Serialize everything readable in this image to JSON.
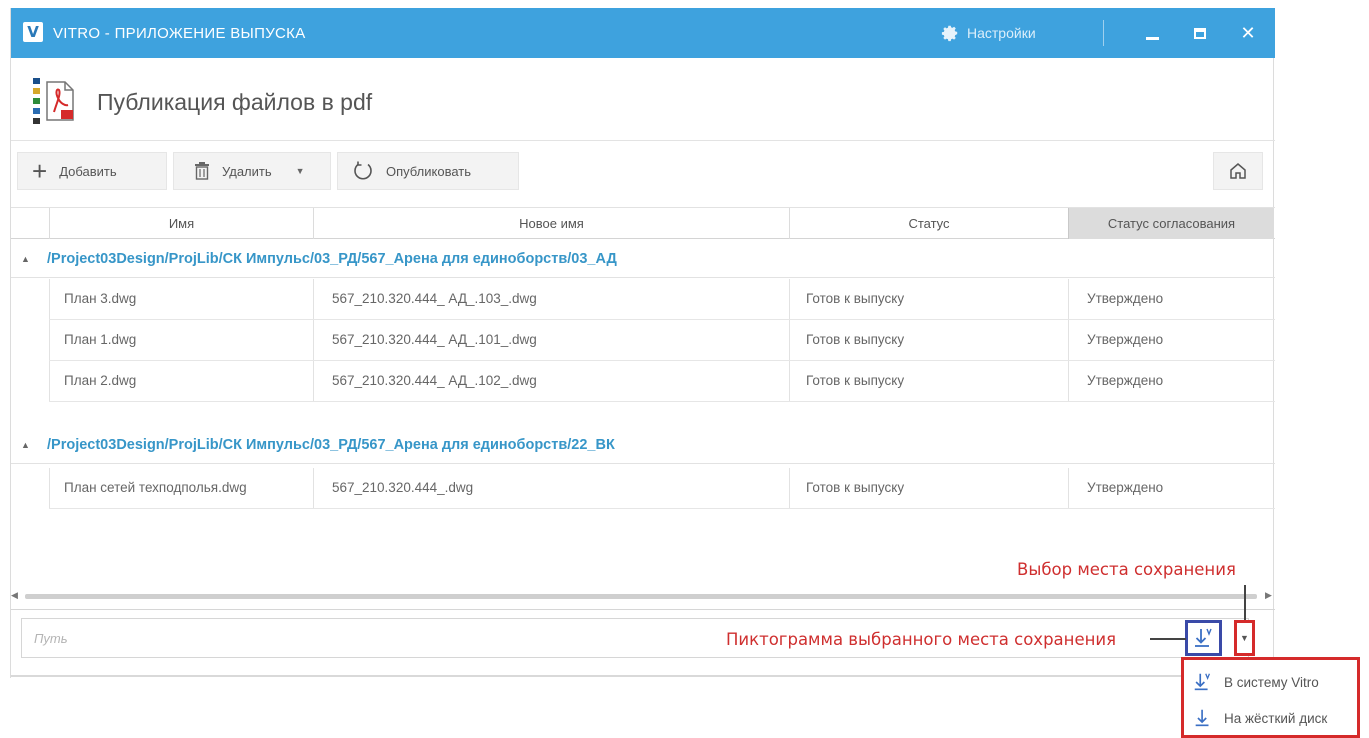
{
  "window": {
    "title": "VITRO - ПРИЛОЖЕНИЕ ВЫПУСКА",
    "logo_letter": "V",
    "settings_label": "Настройки"
  },
  "header": {
    "title": "Публикация файлов в pdf"
  },
  "toolbar": {
    "add_label": "Добавить",
    "delete_label": "Удалить",
    "publish_label": "Опубликовать"
  },
  "table": {
    "columns": [
      "Имя",
      "Новое имя",
      "Статус",
      "Статус согласования"
    ],
    "groups": [
      {
        "path": "/Project03Design/ProjLib/СК Импульс/03_РД/567_Арена для единоборств/03_АД",
        "rows": [
          {
            "name": "План 3.dwg",
            "new_name": "567_210.320.444_ АД_.103_.dwg",
            "status": "Готов к выпуску",
            "approval": "Утверждено"
          },
          {
            "name": "План 1.dwg",
            "new_name": "567_210.320.444_ АД_.101_.dwg",
            "status": "Готов к выпуску",
            "approval": "Утверждено"
          },
          {
            "name": "План 2.dwg",
            "new_name": "567_210.320.444_ АД_.102_.dwg",
            "status": "Готов к выпуску",
            "approval": "Утверждено"
          }
        ]
      },
      {
        "path": "/Project03Design/ProjLib/СК Импульс/03_РД/567_Арена для единоборств/22_ВК",
        "rows": [
          {
            "name": "План сетей техподполья.dwg",
            "new_name": "567_210.320.444_.dwg",
            "status": "Готов к выпуску",
            "approval": "Утверждено"
          }
        ]
      }
    ]
  },
  "path_field": {
    "placeholder": "Путь"
  },
  "annotations": {
    "save_place": "Выбор места сохранения",
    "save_icon": "Пиктограмма выбранного места сохранения"
  },
  "save_menu": {
    "items": [
      {
        "label": "В систему Vitro",
        "icon": "vitro-save-icon"
      },
      {
        "label": "На жёсткий диск",
        "icon": "disk-save-icon"
      }
    ]
  },
  "colors": {
    "titlebar": "#3ea2de",
    "group_path": "#3796c8",
    "annotation_red": "#cf2f2f",
    "selected_icon_border": "#3a4aa8"
  }
}
